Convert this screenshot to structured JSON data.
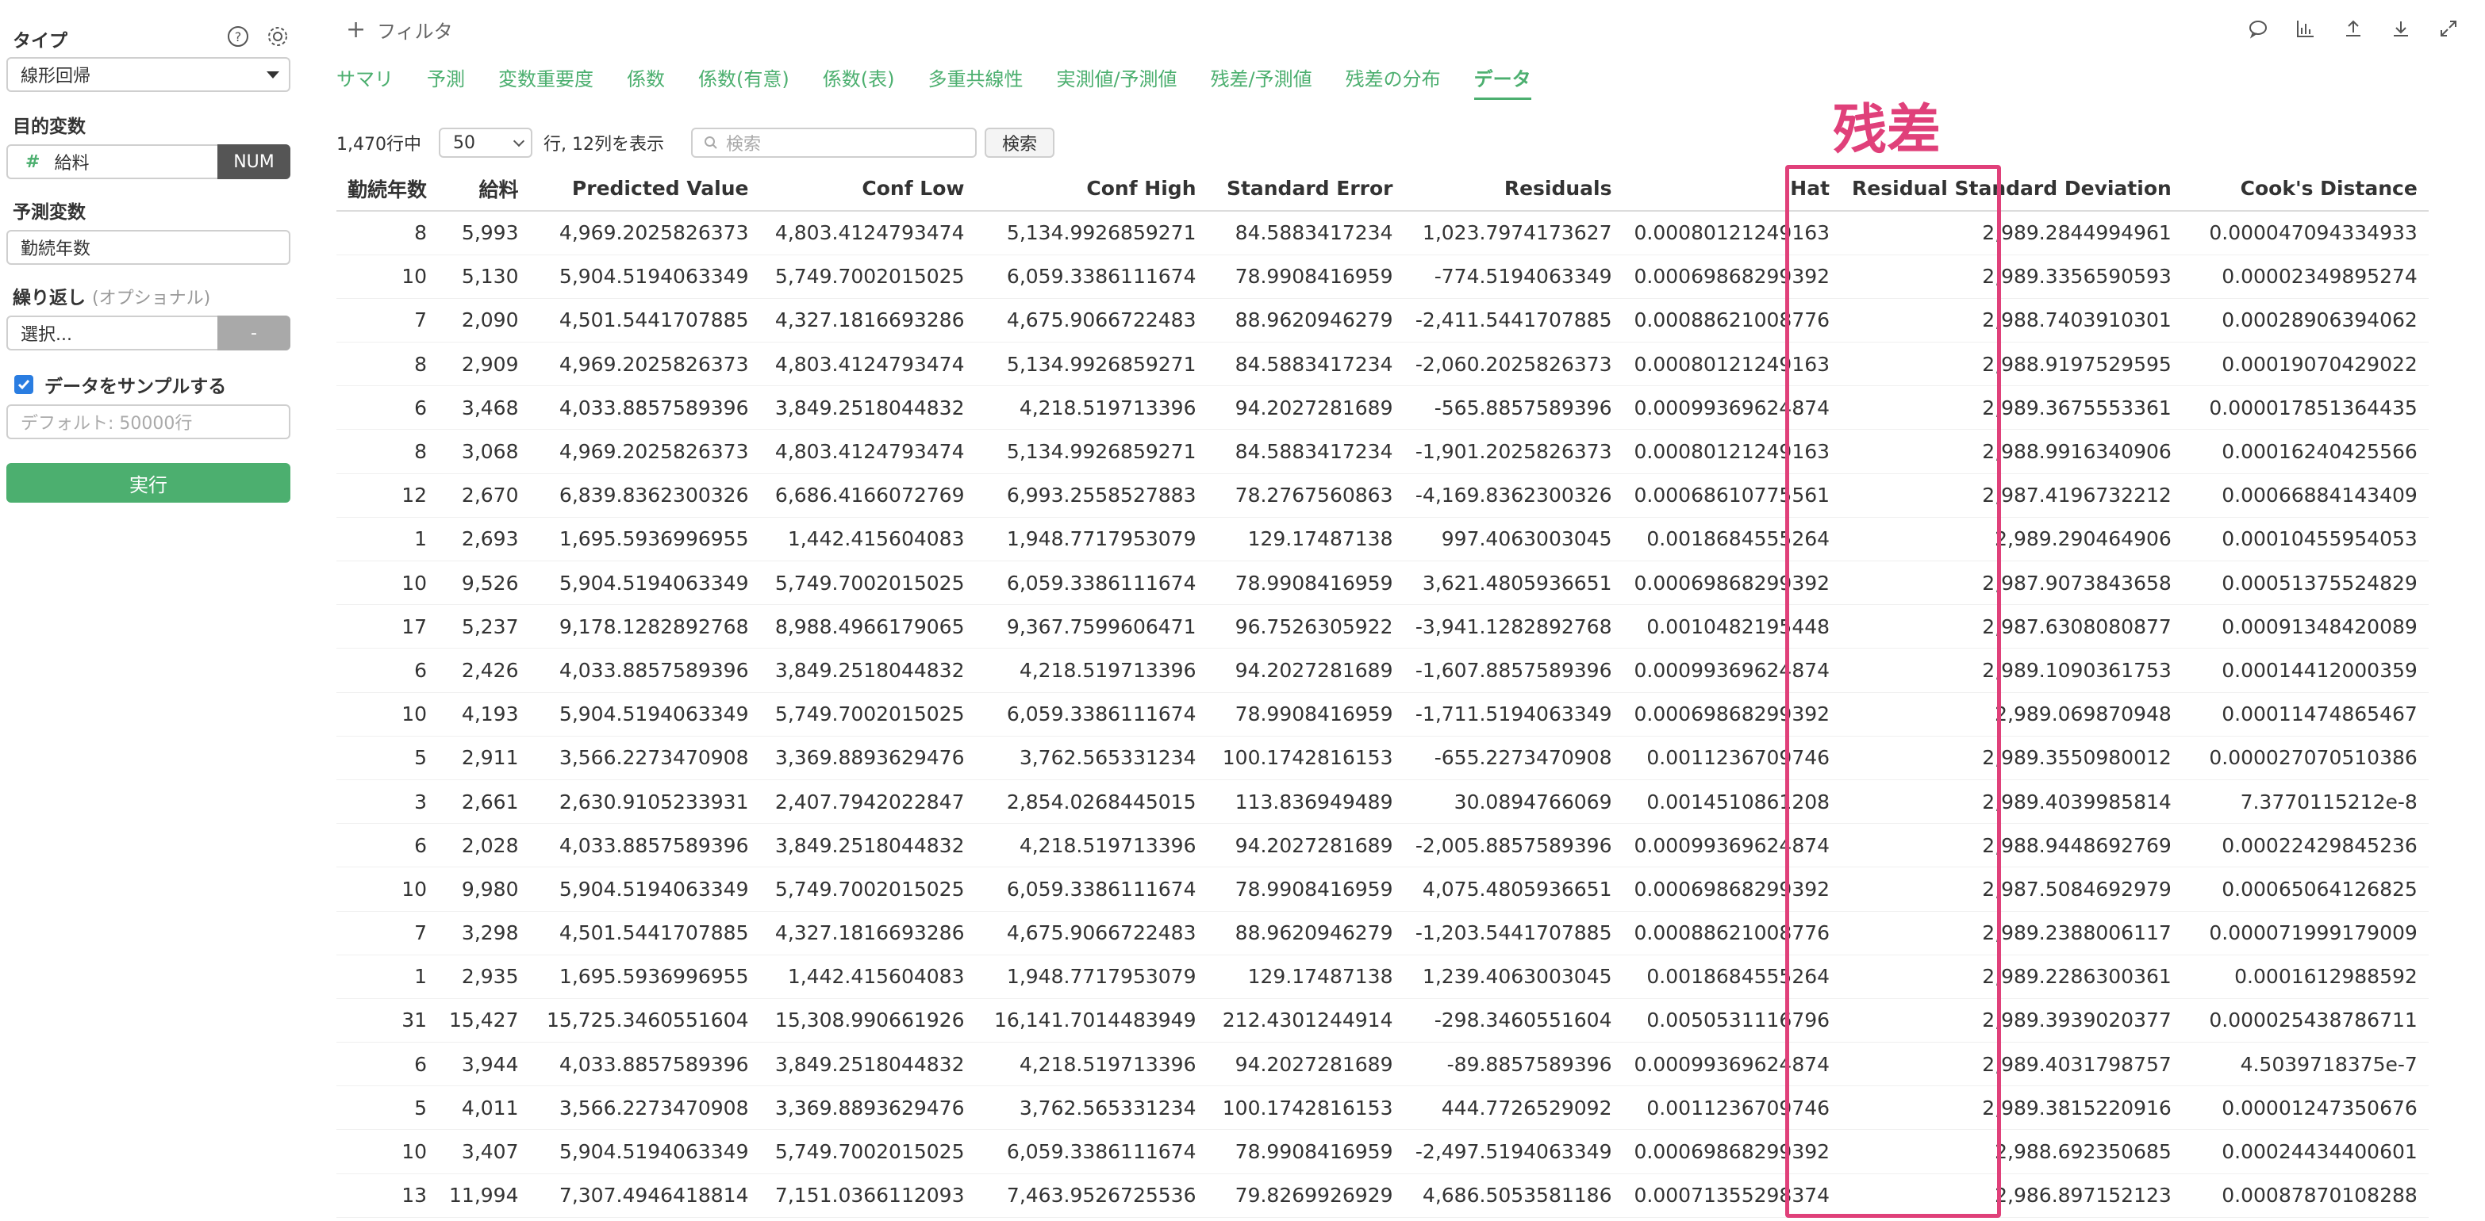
{
  "sidebar": {
    "type_label": "タイプ",
    "type_value": "線形回帰",
    "target_label": "目的変数",
    "target_value": "給料",
    "target_type": "NUM",
    "predictor_label": "予測変数",
    "predictor_value": "勤続年数",
    "repeat_label": "繰り返し",
    "repeat_optional": "(オプショナル)",
    "repeat_placeholder": "選択...",
    "repeat_button": "-",
    "sample_label": "データをサンプルする",
    "sample_placeholder": "デフォルト: 50000行",
    "run_button": "実行"
  },
  "topbar": {
    "filter_label": "フィルタ"
  },
  "tabs": [
    {
      "label": "サマリ"
    },
    {
      "label": "予測"
    },
    {
      "label": "変数重要度"
    },
    {
      "label": "係数"
    },
    {
      "label": "係数(有意)"
    },
    {
      "label": "係数(表)"
    },
    {
      "label": "多重共線性"
    },
    {
      "label": "実測値/予測値"
    },
    {
      "label": "残差/予測値"
    },
    {
      "label": "残差の分布"
    },
    {
      "label": "データ"
    }
  ],
  "controls": {
    "row_count": "1,470行中",
    "page_size": "50",
    "row_col_text": "行, 12列を表示",
    "search_placeholder": "検索",
    "search_button": "検索"
  },
  "highlight": {
    "label": "残差"
  },
  "table": {
    "headers": [
      "勤続年数",
      "給料",
      "Predicted Value",
      "Conf Low",
      "Conf High",
      "Standard Error",
      "Residuals",
      "Hat",
      "Residual Standard Deviation",
      "Cook's Distance"
    ],
    "rows": [
      [
        "8",
        "5,993",
        "4,969.2025826373",
        "4,803.4124793474",
        "5,134.9926859271",
        "84.5883417234",
        "1,023.7974173627",
        "0.00080121249163",
        "2,989.2844994961",
        "0.000047094334933"
      ],
      [
        "10",
        "5,130",
        "5,904.5194063349",
        "5,749.7002015025",
        "6,059.3386111674",
        "78.9908416959",
        "-774.5194063349",
        "0.00069868299392",
        "2,989.3356590593",
        "0.00002349895274"
      ],
      [
        "7",
        "2,090",
        "4,501.5441707885",
        "4,327.1816693286",
        "4,675.9066722483",
        "88.9620946279",
        "-2,411.5441707885",
        "0.00088621008776",
        "2,988.7403910301",
        "0.00028906394062"
      ],
      [
        "8",
        "2,909",
        "4,969.2025826373",
        "4,803.4124793474",
        "5,134.9926859271",
        "84.5883417234",
        "-2,060.2025826373",
        "0.00080121249163",
        "2,988.9197529595",
        "0.00019070429022"
      ],
      [
        "6",
        "3,468",
        "4,033.8857589396",
        "3,849.2518044832",
        "4,218.519713396",
        "94.2027281689",
        "-565.8857589396",
        "0.00099369624874",
        "2,989.3675553361",
        "0.000017851364435"
      ],
      [
        "8",
        "3,068",
        "4,969.2025826373",
        "4,803.4124793474",
        "5,134.9926859271",
        "84.5883417234",
        "-1,901.2025826373",
        "0.00080121249163",
        "2,988.9916340906",
        "0.00016240425566"
      ],
      [
        "12",
        "2,670",
        "6,839.8362300326",
        "6,686.4166072769",
        "6,993.2558527883",
        "78.2767560863",
        "-4,169.8362300326",
        "0.00068610775561",
        "2,987.4196732212",
        "0.00066884143409"
      ],
      [
        "1",
        "2,693",
        "1,695.5936996955",
        "1,442.415604083",
        "1,948.7717953079",
        "129.17487138",
        "997.4063003045",
        "0.0018684555264",
        "2,989.290464906",
        "0.00010455954053"
      ],
      [
        "10",
        "9,526",
        "5,904.5194063349",
        "5,749.7002015025",
        "6,059.3386111674",
        "78.9908416959",
        "3,621.4805936651",
        "0.00069868299392",
        "2,987.9073843658",
        "0.00051375524829"
      ],
      [
        "17",
        "5,237",
        "9,178.1282892768",
        "8,988.4966179065",
        "9,367.7599606471",
        "96.7526305922",
        "-3,941.1282892768",
        "0.0010482195448",
        "2,987.6308080877",
        "0.00091348420089"
      ],
      [
        "6",
        "2,426",
        "4,033.8857589396",
        "3,849.2518044832",
        "4,218.519713396",
        "94.2027281689",
        "-1,607.8857589396",
        "0.00099369624874",
        "2,989.1090361753",
        "0.00014412000359"
      ],
      [
        "10",
        "4,193",
        "5,904.5194063349",
        "5,749.7002015025",
        "6,059.3386111674",
        "78.9908416959",
        "-1,711.5194063349",
        "0.00069868299392",
        "2,989.069870948",
        "0.00011474865467"
      ],
      [
        "5",
        "2,911",
        "3,566.2273470908",
        "3,369.8893629476",
        "3,762.565331234",
        "100.1742816153",
        "-655.2273470908",
        "0.0011236709746",
        "2,989.3550980012",
        "0.000027070510386"
      ],
      [
        "3",
        "2,661",
        "2,630.9105233931",
        "2,407.7942022847",
        "2,854.0268445015",
        "113.836949489",
        "30.0894766069",
        "0.0014510861208",
        "2,989.4039985814",
        "7.3770115212e-8"
      ],
      [
        "6",
        "2,028",
        "4,033.8857589396",
        "3,849.2518044832",
        "4,218.519713396",
        "94.2027281689",
        "-2,005.8857589396",
        "0.00099369624874",
        "2,988.9448692769",
        "0.00022429845236"
      ],
      [
        "10",
        "9,980",
        "5,904.5194063349",
        "5,749.7002015025",
        "6,059.3386111674",
        "78.9908416959",
        "4,075.4805936651",
        "0.00069868299392",
        "2,987.5084692979",
        "0.00065064126825"
      ],
      [
        "7",
        "3,298",
        "4,501.5441707885",
        "4,327.1816693286",
        "4,675.9066722483",
        "88.9620946279",
        "-1,203.5441707885",
        "0.00088621008776",
        "2,989.2388006117",
        "0.000071999179009"
      ],
      [
        "1",
        "2,935",
        "1,695.5936996955",
        "1,442.415604083",
        "1,948.7717953079",
        "129.17487138",
        "1,239.4063003045",
        "0.0018684555264",
        "2,989.2286300361",
        "0.0001612988592"
      ],
      [
        "31",
        "15,427",
        "15,725.3460551604",
        "15,308.990661926",
        "16,141.7014483949",
        "212.4301244914",
        "-298.3460551604",
        "0.0050531116796",
        "2,989.3939020377",
        "0.000025438786711"
      ],
      [
        "6",
        "3,944",
        "4,033.8857589396",
        "3,849.2518044832",
        "4,218.519713396",
        "94.2027281689",
        "-89.8857589396",
        "0.00099369624874",
        "2,989.4031798757",
        "4.5039718375e-7"
      ],
      [
        "5",
        "4,011",
        "3,566.2273470908",
        "3,369.8893629476",
        "3,762.565331234",
        "100.1742816153",
        "444.7726529092",
        "0.0011236709746",
        "2,989.3815220916",
        "0.00001247350676"
      ],
      [
        "10",
        "3,407",
        "5,904.5194063349",
        "5,749.7002015025",
        "6,059.3386111674",
        "78.9908416959",
        "-2,497.5194063349",
        "0.00069868299392",
        "2,988.692350685",
        "0.00024434400601"
      ],
      [
        "13",
        "11,994",
        "7,307.4946418814",
        "7,151.0366112093",
        "7,463.9526725536",
        "79.8269926929",
        "4,686.5053581186",
        "0.00071355298374",
        "2,986.897152123",
        "0.00087870108288"
      ]
    ]
  },
  "colors": {
    "accent_green": "#4caf6f",
    "highlight_pink": "#e0407a"
  }
}
